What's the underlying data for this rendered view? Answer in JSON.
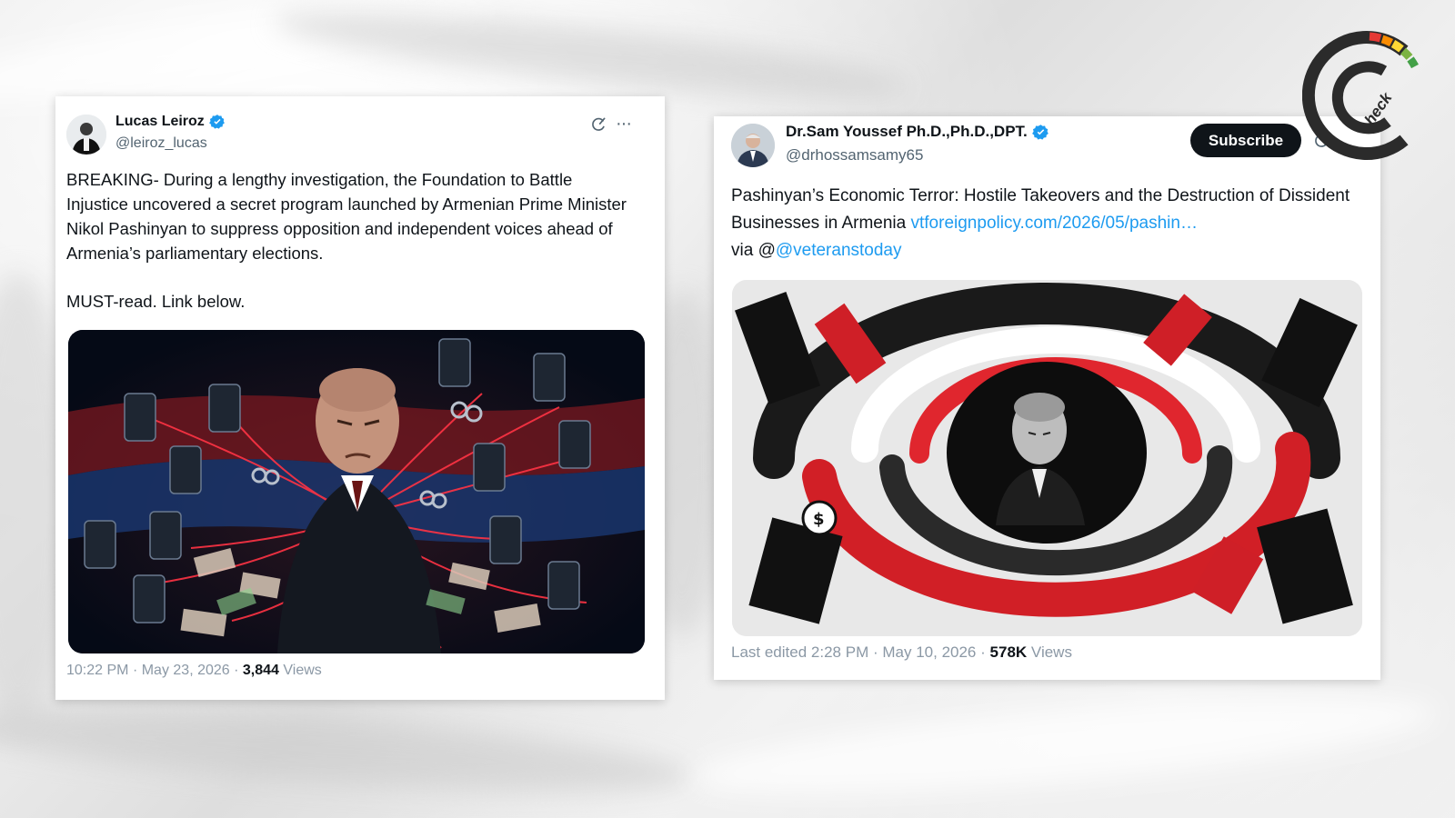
{
  "left_tweet": {
    "author": {
      "display_name": "Lucas Leiroz",
      "handle": "@leiroz_lucas",
      "verified": true
    },
    "text": {
      "paragraph_1": "BREAKING- During a lengthy investigation, the Foundation to Battle Injustice uncovered a secret program launched by Armenian Prime Minister Nikol Pashinyan to suppress opposition and independent voices ahead of Armenia’s parliamentary elections.",
      "paragraph_2": "MUST-read. Link below."
    },
    "meta": {
      "time": "10:22 PM",
      "separator": "·",
      "date": "May 23, 2026",
      "views_count": "3,844",
      "views_label": "Views"
    },
    "icons": [
      "grok-icon",
      "more-icon"
    ]
  },
  "right_tweet": {
    "author": {
      "display_name": "Dr.Sam Youssef Ph.D.,Ph.D.,DPT.",
      "handle": "@drhossamsamy65",
      "verified": true
    },
    "subscribe_label": "Subscribe",
    "text": {
      "title": "Pashinyan’s Economic Terror: Hostile Takeovers and the Destruction of Dissident Businesses in Armenia",
      "link": "vtforeignpolicy.com/2026/05/pashin…",
      "via_prefix": "via @",
      "via_handle": "@veteranstoday"
    },
    "meta": {
      "prefix": "Last edited",
      "time": "2:28 PM",
      "separator": "·",
      "date": "May 10, 2026",
      "views_count": "578K",
      "views_label": "Views"
    },
    "icons": [
      "grok-icon"
    ]
  },
  "logo": {
    "lettering": "Check",
    "colors": [
      "#e53935",
      "#fb8c00",
      "#fdd835",
      "#7cb342",
      "#43a047"
    ]
  },
  "colors": {
    "verified": "#1d9bf0",
    "link": "#1d9bf0",
    "text": "#0f1419",
    "secondary": "#536471"
  }
}
